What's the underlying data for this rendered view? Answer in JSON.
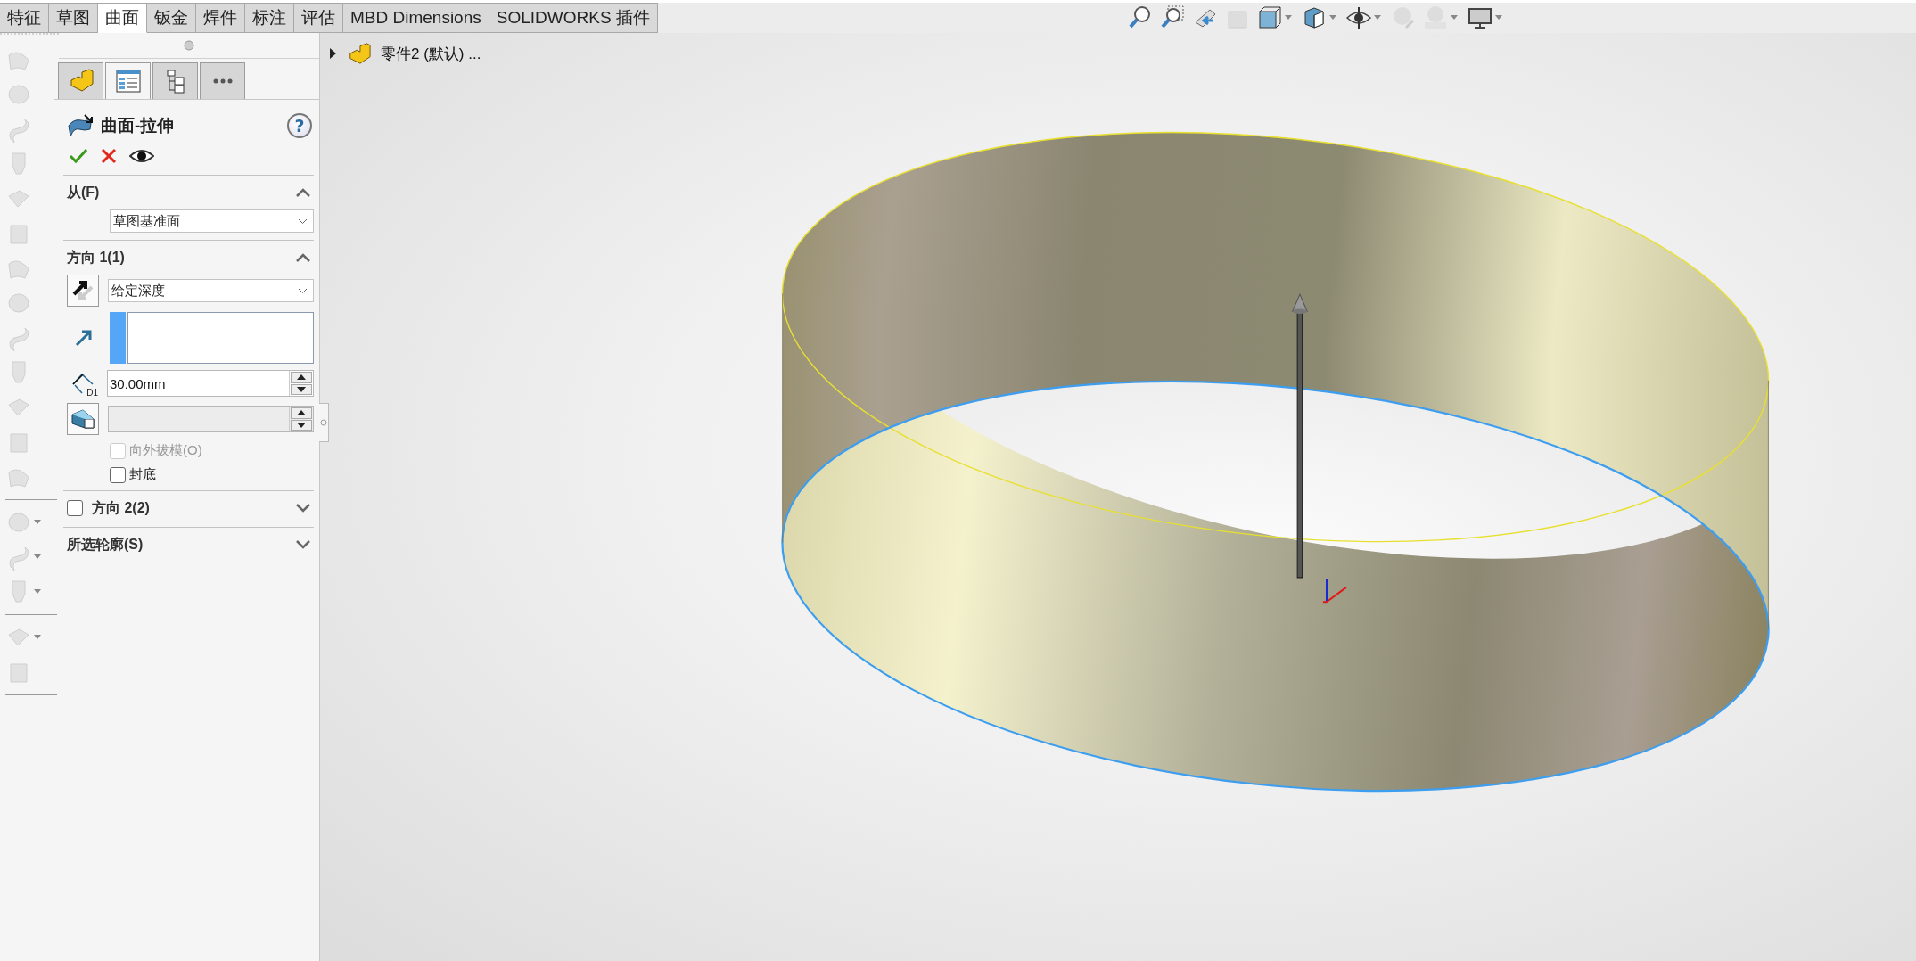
{
  "tabs": [
    {
      "label": "特征",
      "selected": false
    },
    {
      "label": "草图",
      "selected": false
    },
    {
      "label": "曲面",
      "selected": true
    },
    {
      "label": "钣金",
      "selected": false
    },
    {
      "label": "焊件",
      "selected": false
    },
    {
      "label": "标注",
      "selected": false
    },
    {
      "label": "评估",
      "selected": false
    },
    {
      "label": "MBD Dimensions",
      "selected": false
    },
    {
      "label": "SOLIDWORKS 插件",
      "selected": false
    }
  ],
  "tree": {
    "label": "零件2 (默认) ...",
    "expanded": false
  },
  "panel": {
    "tabs": [
      {
        "kind": "feature",
        "selected": false
      },
      {
        "kind": "property",
        "selected": true
      },
      {
        "kind": "config",
        "selected": false
      },
      {
        "kind": "more",
        "selected": false
      }
    ],
    "title": "曲面-拉伸",
    "help": "?",
    "sections": [
      {
        "kind": "from",
        "title": "从(F)",
        "expanded": true,
        "select": "草图基准面"
      },
      {
        "kind": "direction",
        "title": "方向 1(1)",
        "expanded": true,
        "end_condition": "给定深度",
        "dimension_label": "D1",
        "depth": "30.00mm",
        "draft_disabled": true,
        "options": [
          {
            "label": "向外拔模(O)",
            "checked": false,
            "disabled": true
          },
          {
            "label": "封底",
            "checked": false,
            "disabled": false
          }
        ]
      },
      {
        "kind": "direction",
        "title": "方向 2(2)",
        "checked": false,
        "expanded": false
      },
      {
        "kind": "contours",
        "title": "所选轮廓(S)",
        "expanded": false
      }
    ]
  }
}
